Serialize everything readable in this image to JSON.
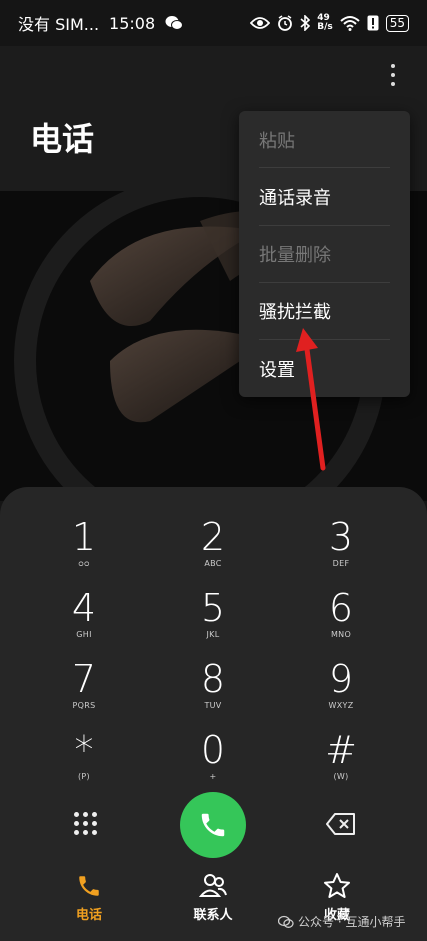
{
  "status_bar": {
    "carrier": "没有 SIM...",
    "time": "15:08",
    "net_speed_value": "49",
    "net_speed_unit": "B/s",
    "battery": "55"
  },
  "header": {
    "title": "电话"
  },
  "menu": {
    "items": [
      {
        "label": "粘贴",
        "enabled": false
      },
      {
        "label": "通话录音",
        "enabled": true
      },
      {
        "label": "批量删除",
        "enabled": false
      },
      {
        "label": "骚扰拦截",
        "enabled": true
      },
      {
        "label": "设置",
        "enabled": true
      }
    ]
  },
  "keypad": {
    "keys": [
      {
        "digit": "1",
        "letters": "ᴑᴑ"
      },
      {
        "digit": "2",
        "letters": "ABC"
      },
      {
        "digit": "3",
        "letters": "DEF"
      },
      {
        "digit": "4",
        "letters": "GHI"
      },
      {
        "digit": "5",
        "letters": "JKL"
      },
      {
        "digit": "6",
        "letters": "MNO"
      },
      {
        "digit": "7",
        "letters": "PQRS"
      },
      {
        "digit": "8",
        "letters": "TUV"
      },
      {
        "digit": "9",
        "letters": "WXYZ"
      },
      {
        "digit": "*",
        "letters": "(P)"
      },
      {
        "digit": "0",
        "letters": "+"
      },
      {
        "digit": "#",
        "letters": "(W)"
      }
    ]
  },
  "nav": {
    "tabs": [
      {
        "label": "电话",
        "active": true
      },
      {
        "label": "联系人",
        "active": false
      },
      {
        "label": "收藏",
        "active": false
      }
    ]
  },
  "watermark": {
    "text": "公众号 · 互通小帮手"
  },
  "colors": {
    "call_green": "#35c659",
    "active_tab": "#f0a020",
    "annotation_red": "#e02020"
  }
}
